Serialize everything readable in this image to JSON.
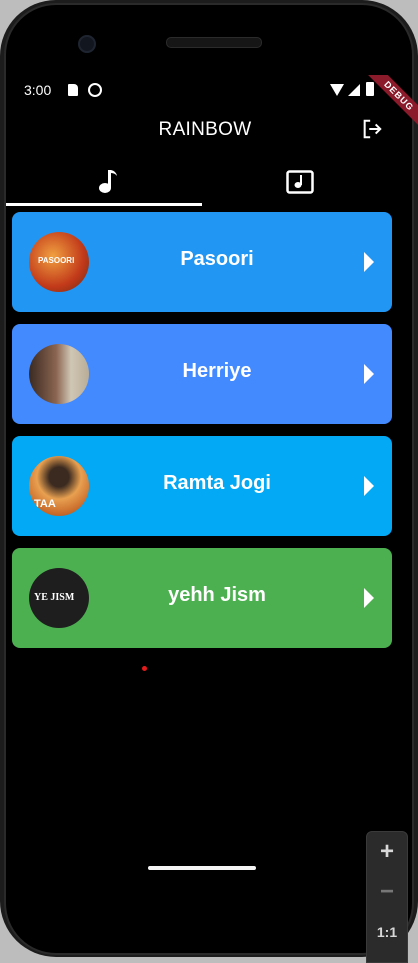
{
  "status_bar": {
    "time": "3:00"
  },
  "debug_banner": "DEBUG",
  "app_bar": {
    "title": "RAINBOW",
    "action_icon": "logout-icon"
  },
  "tabs": [
    {
      "icon": "music-note-icon",
      "selected": true
    },
    {
      "icon": "music-album-icon",
      "selected": false
    }
  ],
  "songs": [
    {
      "title": "Pasoori",
      "color": "#2196F3",
      "thumb_text": "PASOORI",
      "thumb_bg": "#d9651f"
    },
    {
      "title": "Herriye",
      "color": "#448AFF",
      "thumb_text": "",
      "thumb_bg": "#6b4a3b"
    },
    {
      "title": "Ramta Jogi",
      "color": "#03A9F4",
      "thumb_text": "TAA",
      "thumb_bg": "#b8733a"
    },
    {
      "title": "yehh Jism",
      "color": "#4CAF50",
      "thumb_text": "YE JISM",
      "thumb_bg": "#222222"
    }
  ],
  "zoom_control": {
    "zoom_in": "+",
    "zoom_out": "−",
    "reset": "1:1"
  }
}
